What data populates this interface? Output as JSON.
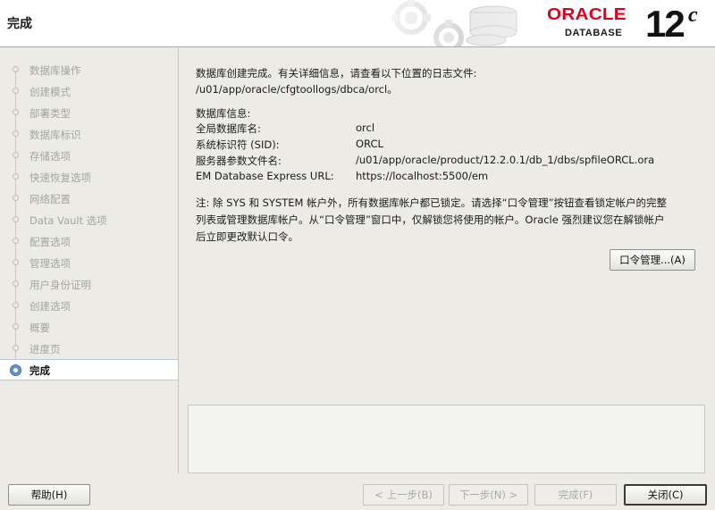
{
  "header": {
    "title": "完成",
    "brand": "ORACLE",
    "product": "DATABASE",
    "version_number": "12",
    "version_suffix": "c"
  },
  "sidebar": {
    "steps": [
      {
        "label": "数据库操作",
        "state": "done"
      },
      {
        "label": "创建模式",
        "state": "done"
      },
      {
        "label": "部署类型",
        "state": "done"
      },
      {
        "label": "数据库标识",
        "state": "done"
      },
      {
        "label": "存储选项",
        "state": "done"
      },
      {
        "label": "快速恢复选项",
        "state": "done"
      },
      {
        "label": "网络配置",
        "state": "done"
      },
      {
        "label": "Data Vault 选项",
        "state": "done"
      },
      {
        "label": "配置选项",
        "state": "done"
      },
      {
        "label": "管理选项",
        "state": "done"
      },
      {
        "label": "用户身份证明",
        "state": "done"
      },
      {
        "label": "创建选项",
        "state": "done"
      },
      {
        "label": "概要",
        "state": "done"
      },
      {
        "label": "进度页",
        "state": "done"
      },
      {
        "label": "完成",
        "state": "active"
      }
    ]
  },
  "main": {
    "intro": "数据库创建完成。有关详细信息，请查看以下位置的日志文件:",
    "log_path": " /u01/app/oracle/cfgtoollogs/dbca/orcl。",
    "db_info_heading": "数据库信息:",
    "db_info": [
      {
        "key": "全局数据库名:",
        "value": "orcl"
      },
      {
        "key": "系统标识符 (SID):",
        "value": "ORCL"
      },
      {
        "key": "服务器参数文件名:",
        "value": "/u01/app/oracle/product/12.2.0.1/db_1/dbs/spfileORCL.ora"
      },
      {
        "key": "EM Database Express URL:",
        "value": "https://localhost:5500/em"
      }
    ],
    "note_lines": [
      "注: 除 SYS 和 SYSTEM 帐户外，所有数据库帐户都已锁定。请选择“口令管理”按钮查看锁定帐户的完整",
      "列表或管理数据库帐户。从“口令管理”窗口中，仅解锁您将使用的帐户。Oracle 强烈建议您在解锁帐户",
      "后立即更改默认口令。"
    ],
    "password_button": "口令管理...(A)"
  },
  "buttons": {
    "help": "帮助(H)",
    "back": "< 上一步(B)",
    "next": "下一步(N) >",
    "finish": "完成(F)",
    "close": "关闭(C)"
  },
  "colors": {
    "brand_red": "#e0001b",
    "window_bg": "#ecebe6",
    "active_step_bg": "#ffffff",
    "disabled_text": "#a9a9a5"
  }
}
